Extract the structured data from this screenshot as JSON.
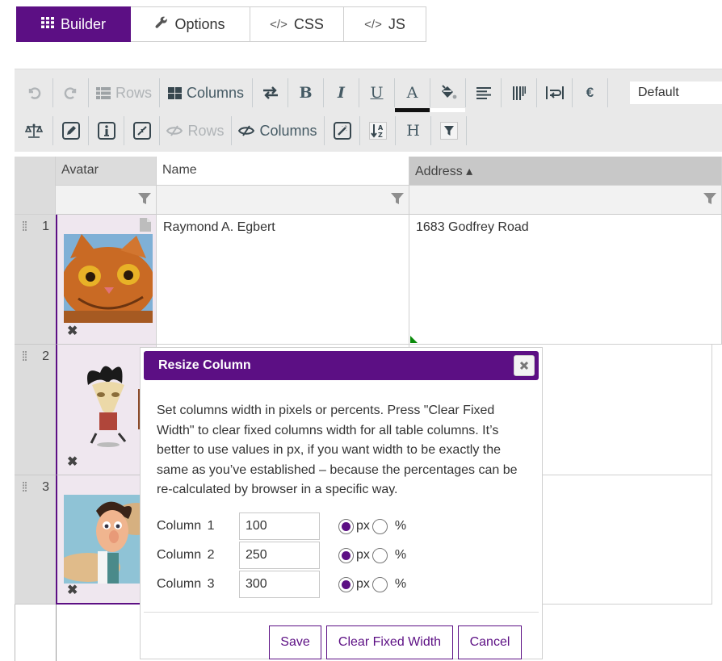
{
  "tabs": [
    {
      "label": "Builder",
      "icon": "grid-icon",
      "active": true
    },
    {
      "label": "Options",
      "icon": "wrench-icon",
      "active": false
    },
    {
      "label": "CSS",
      "icon": "code-icon",
      "active": false
    },
    {
      "label": "JS",
      "icon": "code-icon",
      "active": false
    }
  ],
  "toolbar": {
    "row1": {
      "undo": "undo-icon",
      "redo": "redo-icon",
      "rows_label": "Rows",
      "columns_label": "Columns",
      "font_select_value": "Default",
      "font_color": "#111111",
      "fill_color": "#ffffff"
    },
    "row2": {
      "hidden_rows_label": "Rows",
      "hidden_columns_label": "Columns"
    }
  },
  "table": {
    "columns": [
      {
        "label": "Avatar",
        "sorted": false
      },
      {
        "label": "Name",
        "sorted": false
      },
      {
        "label": "Address ▴",
        "sorted": true
      }
    ],
    "rows": [
      {
        "num": "1",
        "name": "Raymond A. Egbert",
        "address": "1683 Godfrey Road",
        "avatar": "orange-cat"
      },
      {
        "num": "2",
        "name": "",
        "address": "",
        "avatar": "cartoon-character-with-axe"
      },
      {
        "num": "3",
        "name": "",
        "address": "",
        "avatar": "cartoon-scientist"
      }
    ]
  },
  "modal": {
    "title": "Resize Column",
    "description": "Set columns width in pixels or percents. Press \"Clear Fixed Width\" to clear fixed columns width for all table columns. It’s better to use values in px, if you want width to be exactly the same as you’ve established – because the percentages can be re-calculated by browser in a specific way.",
    "columns": [
      {
        "label": "Column 1",
        "value": "100",
        "unit": "px"
      },
      {
        "label": "Column 2",
        "value": "250",
        "unit": "px"
      },
      {
        "label": "Column 3",
        "value": "300",
        "unit": "px"
      }
    ],
    "unit_px": "px",
    "unit_pct": "%",
    "buttons": {
      "save": "Save",
      "clear": "Clear Fixed Width",
      "cancel": "Cancel"
    }
  },
  "colors": {
    "accent": "#5c0f84",
    "selected_cell": "#efe7ef",
    "comment_marker": "#0a8a0a"
  }
}
